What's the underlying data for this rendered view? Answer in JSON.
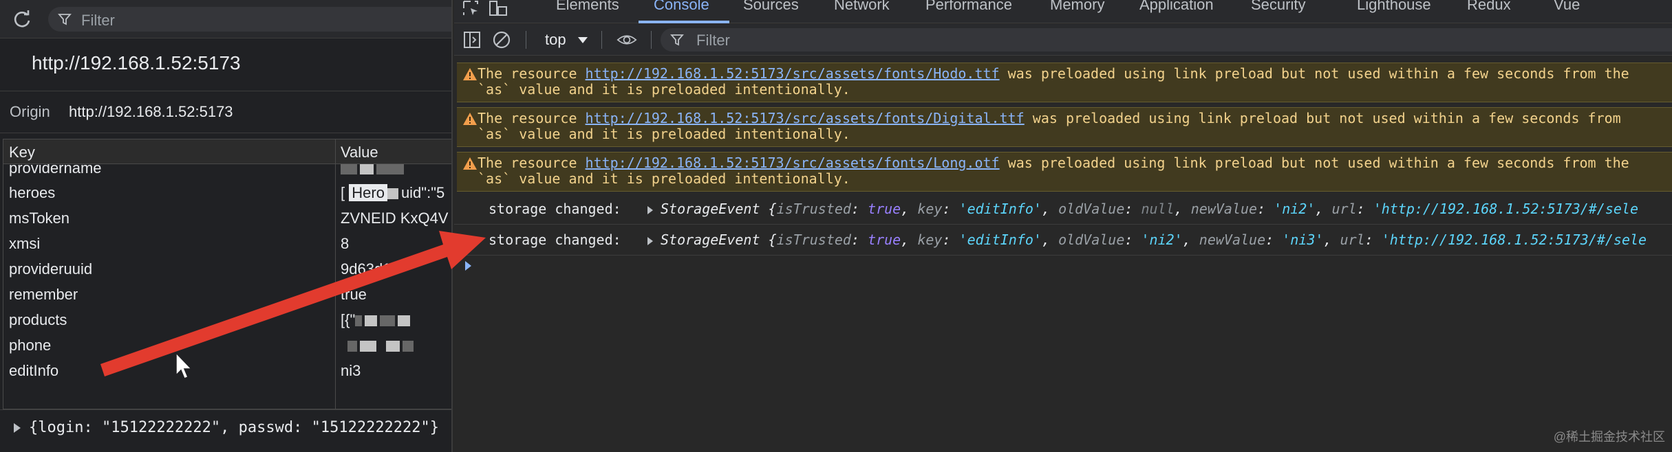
{
  "left_panel": {
    "filter_placeholder": "Filter",
    "origin_title": "http://192.168.1.52:5173",
    "origin_label": "Origin",
    "origin_value": "http://192.168.1.52:5173",
    "table": {
      "headers": {
        "key": "Key",
        "value": "Value"
      },
      "rows": [
        {
          "key": "providername",
          "value": ""
        },
        {
          "key": "heroes",
          "value": "[",
          "tooltip": "Hero"
        },
        {
          "key": "msToken",
          "value": "ZVNEID   KxQ4V"
        },
        {
          "key": "xmsi",
          "value": "8"
        },
        {
          "key": "provideruuid",
          "value": "9d63d1"
        },
        {
          "key": "remember",
          "value": "true"
        },
        {
          "key": "products",
          "value": "[{\""
        },
        {
          "key": "phone",
          "value": ""
        },
        {
          "key": "editInfo",
          "value": "ni3"
        }
      ]
    },
    "preview": "{login: \"15122222222\", passwd: \"15122222222\"}"
  },
  "devtools": {
    "tabs": [
      "Elements",
      "Console",
      "Sources",
      "Network",
      "Performance",
      "Memory",
      "Application",
      "Security",
      "Lighthouse",
      "Redux",
      "Vue"
    ],
    "active_tab": "Console",
    "context": "top",
    "filter_placeholder": "Filter",
    "warnings": [
      {
        "prefix": "The resource ",
        "url": "http://192.168.1.52:5173/src/assets/fonts/Hodo.ttf",
        "suffix": " was preloaded using link preload but not used within a few seconds from the",
        "line2": "`as` value and it is preloaded intentionally."
      },
      {
        "prefix": "The resource ",
        "url": "http://192.168.1.52:5173/src/assets/fonts/Digital.ttf",
        "suffix": " was preloaded using link preload but not used within a few seconds from",
        "line2": "`as` value and it is preloaded intentionally."
      },
      {
        "prefix": "The resource ",
        "url": "http://192.168.1.52:5173/src/assets/fonts/Long.otf",
        "suffix": " was preloaded using link preload but not used within a few seconds from the",
        "line2": "`as` value and it is preloaded intentionally."
      }
    ],
    "logs": [
      {
        "label": "storage changed:",
        "class_name": "StorageEvent",
        "isTrusted": "true",
        "key": "'editInfo'",
        "oldValue": "null",
        "newValue": "'ni2'",
        "url": "'http://192.168.1.52:5173/#/sele"
      },
      {
        "label": "storage changed:",
        "class_name": "StorageEvent",
        "isTrusted": "true",
        "key": "'editInfo'",
        "oldValue": "'ni2'",
        "newValue": "'ni3'",
        "url": "'http://192.168.1.52:5173/#/sele"
      }
    ],
    "watermark": "@稀土掘金技术社区"
  },
  "colors": {
    "arrow": "#e23b2e",
    "accent": "#8ab4f8",
    "warning_bg": "#413a1f",
    "warning_text": "#f2d28c",
    "string": "#5cd5fb",
    "keyword": "#9980ff"
  },
  "icons": [
    "refresh-icon",
    "filter-icon",
    "inspect-icon",
    "device-toggle-icon",
    "sidebar-toggle-icon",
    "clear-console-icon",
    "eye-icon",
    "warning-icon"
  ]
}
